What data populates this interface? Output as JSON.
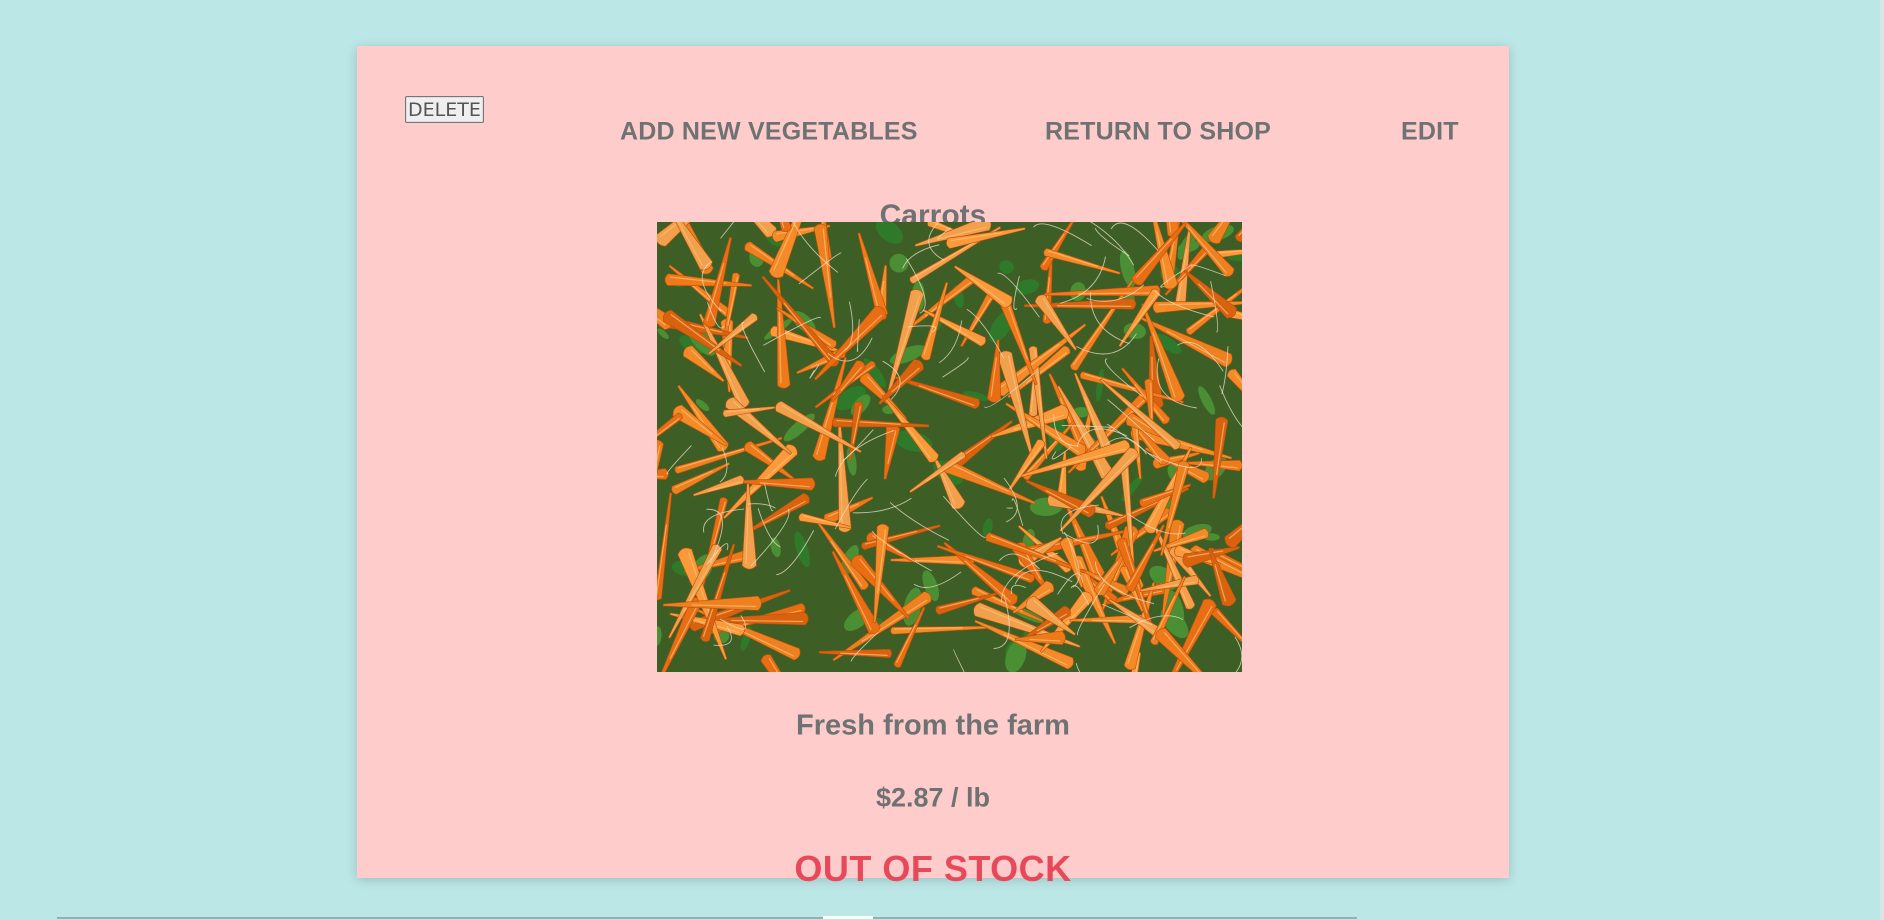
{
  "nav": {
    "delete_label": "DELETE",
    "add_label": "ADD NEW VEGETABLES",
    "return_label": "RETURN TO SHOP",
    "edit_label": "EDIT"
  },
  "product": {
    "name": "Carrots",
    "description": "Fresh from the farm",
    "price": "$2.87 / lb",
    "status": "OUT OF STOCK"
  },
  "colors": {
    "page_background": "#bce7e7",
    "card_background": "#ffcccc",
    "text": "#6f7272",
    "status": "#e8495a"
  }
}
